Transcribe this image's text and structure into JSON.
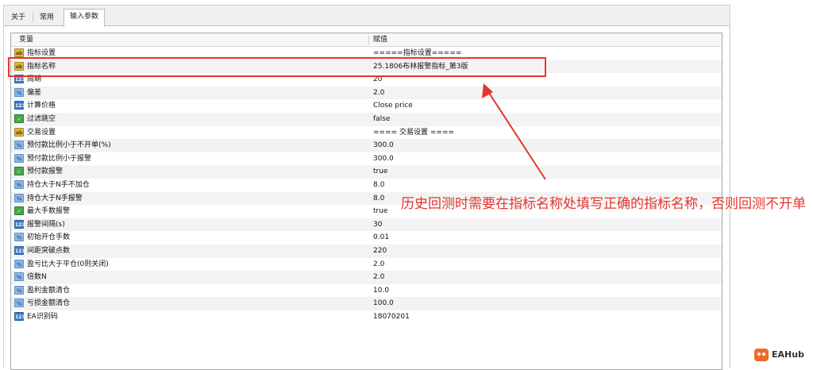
{
  "tabs": [
    {
      "label": "关于",
      "active": false
    },
    {
      "label": "常用",
      "active": false
    },
    {
      "label": "输入参数",
      "active": true
    }
  ],
  "table": {
    "headers": {
      "variable": "变量",
      "value": "赋值"
    },
    "rows": [
      {
        "icon": "ab",
        "name": "指标设置",
        "value": "=====指标设置====="
      },
      {
        "icon": "ab",
        "name": "指标名称",
        "value": "25.1806布林报警指标_第3版"
      },
      {
        "icon": "num",
        "name": "周期",
        "value": "20"
      },
      {
        "icon": "frac",
        "name": "偏差",
        "value": "2.0"
      },
      {
        "icon": "num",
        "name": "计算价格",
        "value": "Close price"
      },
      {
        "icon": "bool",
        "name": "过滤跳空",
        "value": "false"
      },
      {
        "icon": "ab",
        "name": "交易设置",
        "value": "==== 交易设置 ===="
      },
      {
        "icon": "frac",
        "name": "预付款比例小于不开单(%)",
        "value": "300.0"
      },
      {
        "icon": "frac",
        "name": "预付款比例小于报警",
        "value": "300.0"
      },
      {
        "icon": "bool",
        "name": "预付款报警",
        "value": "true"
      },
      {
        "icon": "frac",
        "name": "持仓大于N手不加仓",
        "value": "8.0"
      },
      {
        "icon": "frac",
        "name": "持仓大于N手报警",
        "value": "8.0"
      },
      {
        "icon": "bool",
        "name": "最大手数报警",
        "value": "true"
      },
      {
        "icon": "num",
        "name": "报警间隔(s)",
        "value": "30"
      },
      {
        "icon": "frac",
        "name": "初始开仓手数",
        "value": "0.01"
      },
      {
        "icon": "num",
        "name": "间距突破点数",
        "value": "220"
      },
      {
        "icon": "frac",
        "name": "盈亏比大于平仓(0则关闭)",
        "value": "2.0"
      },
      {
        "icon": "frac",
        "name": "倍数N",
        "value": "2.0"
      },
      {
        "icon": "frac",
        "name": "盈利金额清仓",
        "value": "10.0"
      },
      {
        "icon": "frac",
        "name": "亏损金额清仓",
        "value": "100.0"
      },
      {
        "icon": "num",
        "name": "EA识别码",
        "value": "18070201"
      }
    ]
  },
  "icon_glyphs": {
    "ab": "ab",
    "num": "123",
    "frac": "½",
    "bool": "✓"
  },
  "icon_names": {
    "ab": "string-type-icon",
    "num": "integer-type-icon",
    "frac": "double-type-icon",
    "bool": "boolean-type-icon"
  },
  "annotation": {
    "text": "历史回测时需要在指标名称处填写正确的指标名称，否则回测不开单",
    "color": "#e5352f"
  },
  "logo": {
    "text": "EAHub",
    "color": "#ee6a2c"
  }
}
